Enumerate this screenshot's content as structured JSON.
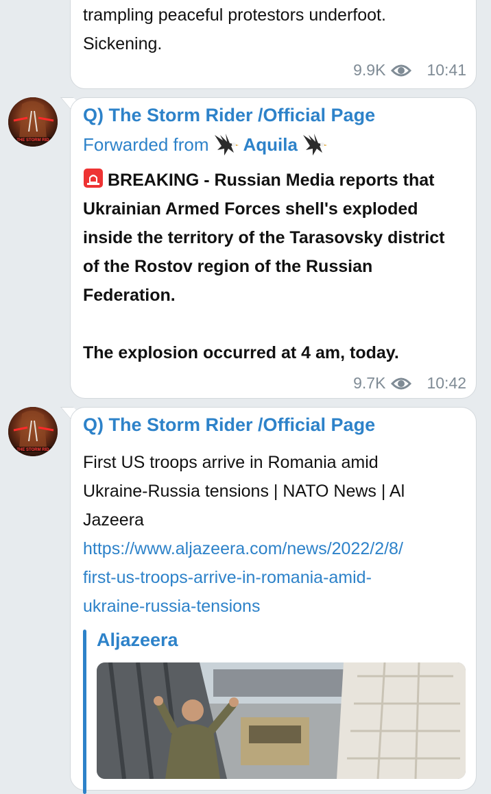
{
  "messages": [
    {
      "text_lines": [
        "trampling peaceful protestors underfoot.",
        "Sickening."
      ],
      "views": "9.9K",
      "time": "10:41"
    },
    {
      "sender": "Q) The Storm Rider /Official Page",
      "forwarded_label": "Forwarded from",
      "forwarded_name": "Aquila",
      "body_lines": [
        "BREAKING - Russian Media reports that",
        "Ukrainian Armed Forces shell's exploded",
        "inside the territory of the Tarasovsky district",
        "of the Rostov region of the Russian",
        "Federation.",
        "",
        "The explosion occurred at 4 am, today."
      ],
      "views": "9.7K",
      "time": "10:42",
      "avatar_text": "THE STORM RID"
    },
    {
      "sender": "Q) The Storm Rider /Official Page",
      "body_lines": [
        "First US troops arrive in Romania amid",
        "Ukraine-Russia tensions | NATO News | Al",
        "Jazeera"
      ],
      "link_lines": [
        "https://www.aljazeera.com/news/2022/2/8/",
        "first-us-troops-arrive-in-romania-amid-",
        "ukraine-russia-tensions"
      ],
      "preview_site": "Aljazeera",
      "avatar_text": "THE STORM RID"
    }
  ],
  "colors": {
    "accent": "#2d82c9",
    "background": "#e7ebee",
    "meta": "#7f8b95"
  },
  "icons": {
    "views": "eye-icon",
    "forward_emoji": "eagle-icon",
    "breaking_emoji": "siren-icon"
  }
}
